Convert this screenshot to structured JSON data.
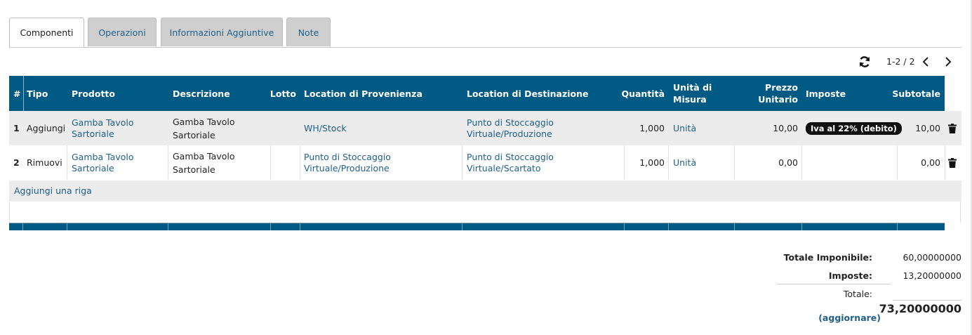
{
  "tabs": [
    "Componenti",
    "Operazioni",
    "Informazioni Aggiuntive",
    "Note"
  ],
  "pager": {
    "range": "1-2 / 2",
    "refresh_icon": "refresh-icon",
    "prev_icon": "chevron-left-icon",
    "next_icon": "chevron-right-icon"
  },
  "table": {
    "headers": {
      "num": "#",
      "tipo": "Tipo",
      "prodotto": "Prodotto",
      "descrizione": "Descrizione",
      "lotto": "Lotto",
      "provenienza": "Location di Provenienza",
      "destinazione": "Location di Destinazione",
      "quantita": "Quantità",
      "unita_line1": "Unità di",
      "unita_line2": "Misura",
      "prezzo_line1": "Prezzo",
      "prezzo_line2": "Unitario",
      "imposte": "Imposte",
      "subtotale": "Subtotale"
    },
    "rows": [
      {
        "num": "1",
        "tipo": "Aggiungi",
        "prodotto": "Gamba Tavolo Sartoriale",
        "descrizione": "Gamba Tavolo Sartoriale",
        "lotto": "",
        "provenienza": "WH/Stock",
        "destinazione": "Punto di Stoccaggio Virtuale/Produzione",
        "quantita": "1,000",
        "unita": "Unità",
        "prezzo": "10,00",
        "imposte": "Iva al 22% (debito)",
        "subtotale": "10,00"
      },
      {
        "num": "2",
        "tipo": "Rimuovi",
        "prodotto": "Gamba Tavolo Sartoriale",
        "descrizione": "Gamba Tavolo Sartoriale",
        "lotto": "",
        "provenienza": "Punto di Stoccaggio Virtuale/Produzione",
        "destinazione": "Punto di Stoccaggio Virtuale/Scartato",
        "quantita": "1,000",
        "unita": "Unità",
        "prezzo": "0,00",
        "imposte": "",
        "subtotale": "0,00"
      }
    ],
    "add_line": "Aggiungi una riga",
    "delete_icon": "trash-icon"
  },
  "totals": {
    "imponibile_label": "Totale Imponibile:",
    "imponibile_value": "60,00000000",
    "imposte_label": "Imposte:",
    "imposte_value": "13,20000000",
    "totale_label": "Totale:",
    "totale_value": "73,20000000",
    "update_link": "(aggiornare)"
  },
  "colors": {
    "header_bg": "#005a84",
    "link": "#1f5f8b",
    "row_alt": "#ececec"
  }
}
